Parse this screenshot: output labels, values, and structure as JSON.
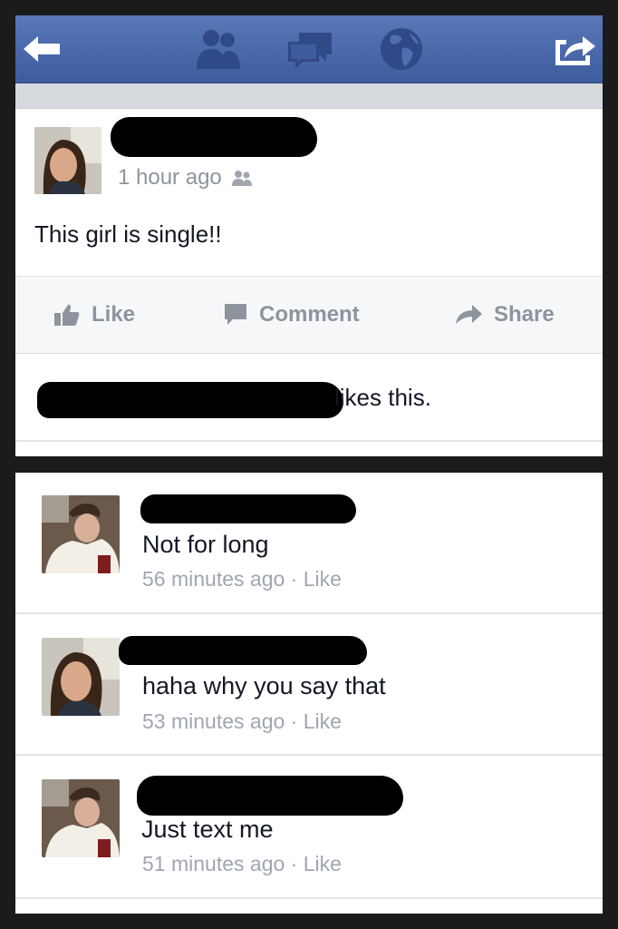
{
  "nav": {
    "icons": [
      "back-arrow-icon",
      "friend-requests-icon",
      "messages-icon",
      "notifications-globe-icon",
      "share-out-icon"
    ]
  },
  "post": {
    "timestamp": "1 hour ago",
    "text": "This girl is single!!",
    "actions": {
      "like": "Like",
      "comment": "Comment",
      "share": "Share"
    },
    "likes_suffix": "likes this."
  },
  "comments": [
    {
      "text": "Not for long",
      "time": "56 minutes ago",
      "sep": " · ",
      "like": "Like"
    },
    {
      "text": "haha why you say that",
      "time": "53 minutes ago",
      "sep": " · ",
      "like": "Like"
    },
    {
      "text": "Just text me",
      "time": "51 minutes ago",
      "sep": " · ",
      "like": "Like"
    }
  ],
  "colors": {
    "nav_blue": "#4a67a8",
    "link_gray": "#8d949e",
    "text": "#141823"
  }
}
